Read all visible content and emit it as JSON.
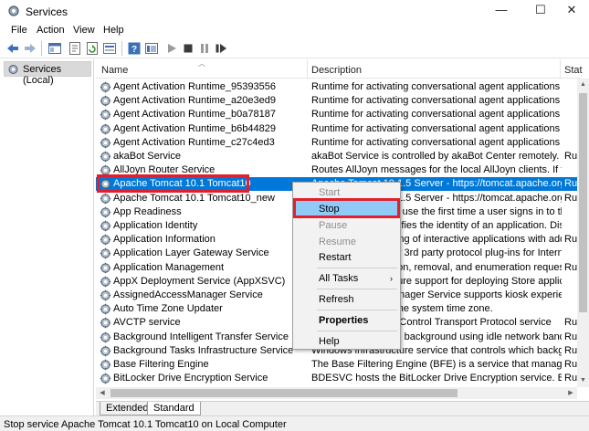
{
  "window": {
    "title": "Services",
    "min_glyph": "—",
    "max_glyph": "☐",
    "close_glyph": "✕"
  },
  "menu": [
    "File",
    "Action",
    "View",
    "Help"
  ],
  "tree": {
    "root_label": "Services (Local)"
  },
  "columns": {
    "name": "Name",
    "description": "Description",
    "status": "Stat"
  },
  "rows": [
    {
      "name": "Agent Activation Runtime_95393556",
      "description": "Runtime for activating conversational agent applications",
      "status": ""
    },
    {
      "name": "Agent Activation Runtime_a20e3ed9",
      "description": "Runtime for activating conversational agent applications",
      "status": ""
    },
    {
      "name": "Agent Activation Runtime_b0a78187",
      "description": "Runtime for activating conversational agent applications",
      "status": ""
    },
    {
      "name": "Agent Activation Runtime_b6b44829",
      "description": "Runtime for activating conversational agent applications",
      "status": ""
    },
    {
      "name": "Agent Activation Runtime_c27c4ed3",
      "description": "Runtime for activating conversational agent applications",
      "status": ""
    },
    {
      "name": "akaBot Service",
      "description": "akaBot Service is controlled by akaBot Center remotely. It hel...",
      "status": "Run"
    },
    {
      "name": "AllJoyn Router Service",
      "description": "Routes AllJoyn messages for the local AllJoyn clients. If this se...",
      "status": ""
    },
    {
      "name": "Apache Tomcat 10.1 Tomcat10",
      "description": "Apache Tomcat 10.1.5 Server - https://tomcat.apache.org/",
      "status": "Run"
    },
    {
      "name": "Apache Tomcat 10.1 Tomcat10_new",
      "description": "Apache Tomcat 10.1.5 Server - https://tomcat.apache.org/",
      "status": "Run"
    },
    {
      "name": "App Readiness",
      "description": "Gets apps ready for use the first time a user signs in to this PC...",
      "status": ""
    },
    {
      "name": "Application Identity",
      "description": "Determines and verifies the identity of an application. Disabli...",
      "status": ""
    },
    {
      "name": "Application Information",
      "description": "Facilitates the running of interactive applications with additional...",
      "status": "Run"
    },
    {
      "name": "Application Layer Gateway Service",
      "description": "Provides support for 3rd party protocol plug-ins for Internet C...",
      "status": ""
    },
    {
      "name": "Application Management",
      "description": "Processes installation, removal, and enumeration requests for...",
      "status": "Run"
    },
    {
      "name": "AppX Deployment Service (AppXSVC)",
      "description": "Provides infrastructure support for deploying Store applicatio...",
      "status": ""
    },
    {
      "name": "AssignedAccessManager Service",
      "description": "AssignedAccessManager Service supports kiosk experience in...",
      "status": ""
    },
    {
      "name": "Auto Time Zone Updater",
      "description": "Automatically sets the system time zone.",
      "status": ""
    },
    {
      "name": "AVCTP service",
      "description": "This is Audio Video Control Transport Protocol service",
      "status": "Run"
    },
    {
      "name": "Background Intelligent Transfer Service",
      "description": "Transfers files in the background using idle network bandwidt...",
      "status": "Run"
    },
    {
      "name": "Background Tasks Infrastructure Service",
      "description": "Windows infrastructure service that controls which backgrou...",
      "status": "Run"
    },
    {
      "name": "Base Filtering Engine",
      "description": "The Base Filtering Engine (BFE) is a service that manages fire...",
      "status": "Run"
    },
    {
      "name": "BitLocker Drive Encryption Service",
      "description": "BDESVC hosts the BitLocker Drive Encryption service. BitLocke...",
      "status": "Run"
    }
  ],
  "selected_index": 7,
  "context_menu": {
    "start": "Start",
    "stop": "Stop",
    "pause": "Pause",
    "resume": "Resume",
    "restart": "Restart",
    "all_tasks": "All Tasks",
    "refresh": "Refresh",
    "properties": "Properties",
    "help": "Help",
    "submenu_arrow": "›"
  },
  "tabs": {
    "extended": "Extended",
    "standard": "Standard"
  },
  "status_bar": {
    "text": "Stop service Apache Tomcat 10.1 Tomcat10 on Local Computer"
  },
  "colors": {
    "selection": "#0078d7",
    "menu_hover": "#91c9f7",
    "highlight_box": "#e0202e"
  }
}
